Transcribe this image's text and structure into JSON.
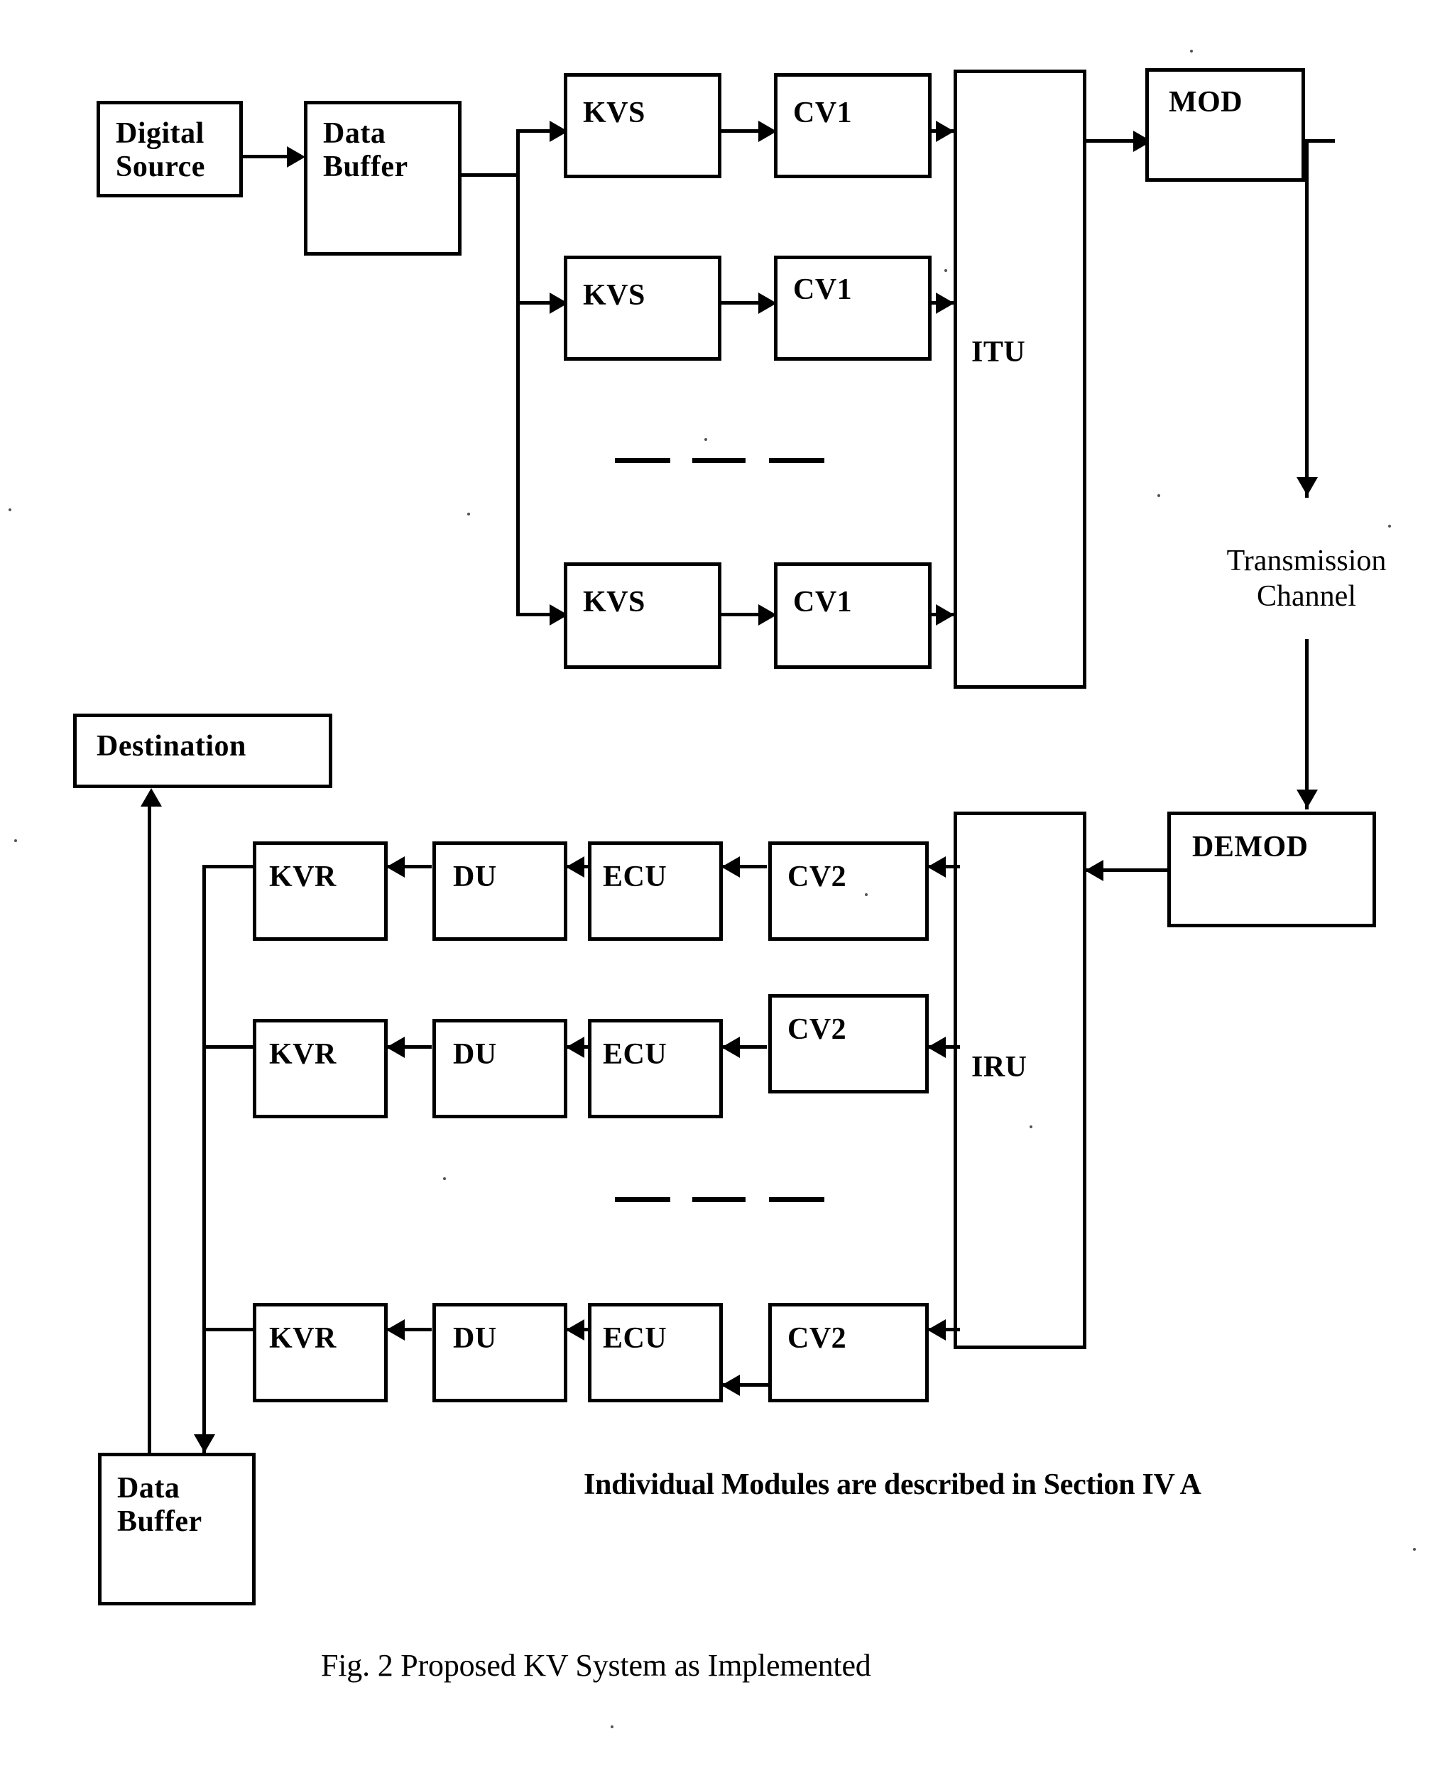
{
  "figure": {
    "caption": "Fig. 2 Proposed KV System as Implemented",
    "note": "Individual Modules are described in Section IV A",
    "channel_label": "Transmission\nChannel"
  },
  "transmitter": {
    "source": {
      "label": "Digital\nSource"
    },
    "buffer": {
      "label": "Data\nBuffer"
    },
    "branches": [
      {
        "kvs": "KVS",
        "cv": "CV1"
      },
      {
        "kvs": "KVS",
        "cv": "CV1"
      },
      {
        "kvs": "KVS",
        "cv": "CV1"
      }
    ],
    "itu": {
      "label": "ITU"
    },
    "mod": {
      "label": "MOD"
    }
  },
  "receiver": {
    "demod": {
      "label": "DEMOD"
    },
    "iru": {
      "label": "IRU"
    },
    "branches": [
      {
        "cv": "CV2",
        "ecu": "ECU",
        "du": "DU",
        "kvr": "KVR"
      },
      {
        "cv": "CV2",
        "ecu": "ECU",
        "du": "DU",
        "kvr": "KVR"
      },
      {
        "cv": "CV2",
        "ecu": "ECU",
        "du": "DU",
        "kvr": "KVR"
      }
    ],
    "destination": {
      "label": "Destination"
    },
    "buffer": {
      "label": "Data\nBuffer"
    }
  },
  "colors": {
    "ink": "#000000",
    "paper": "#ffffff"
  }
}
